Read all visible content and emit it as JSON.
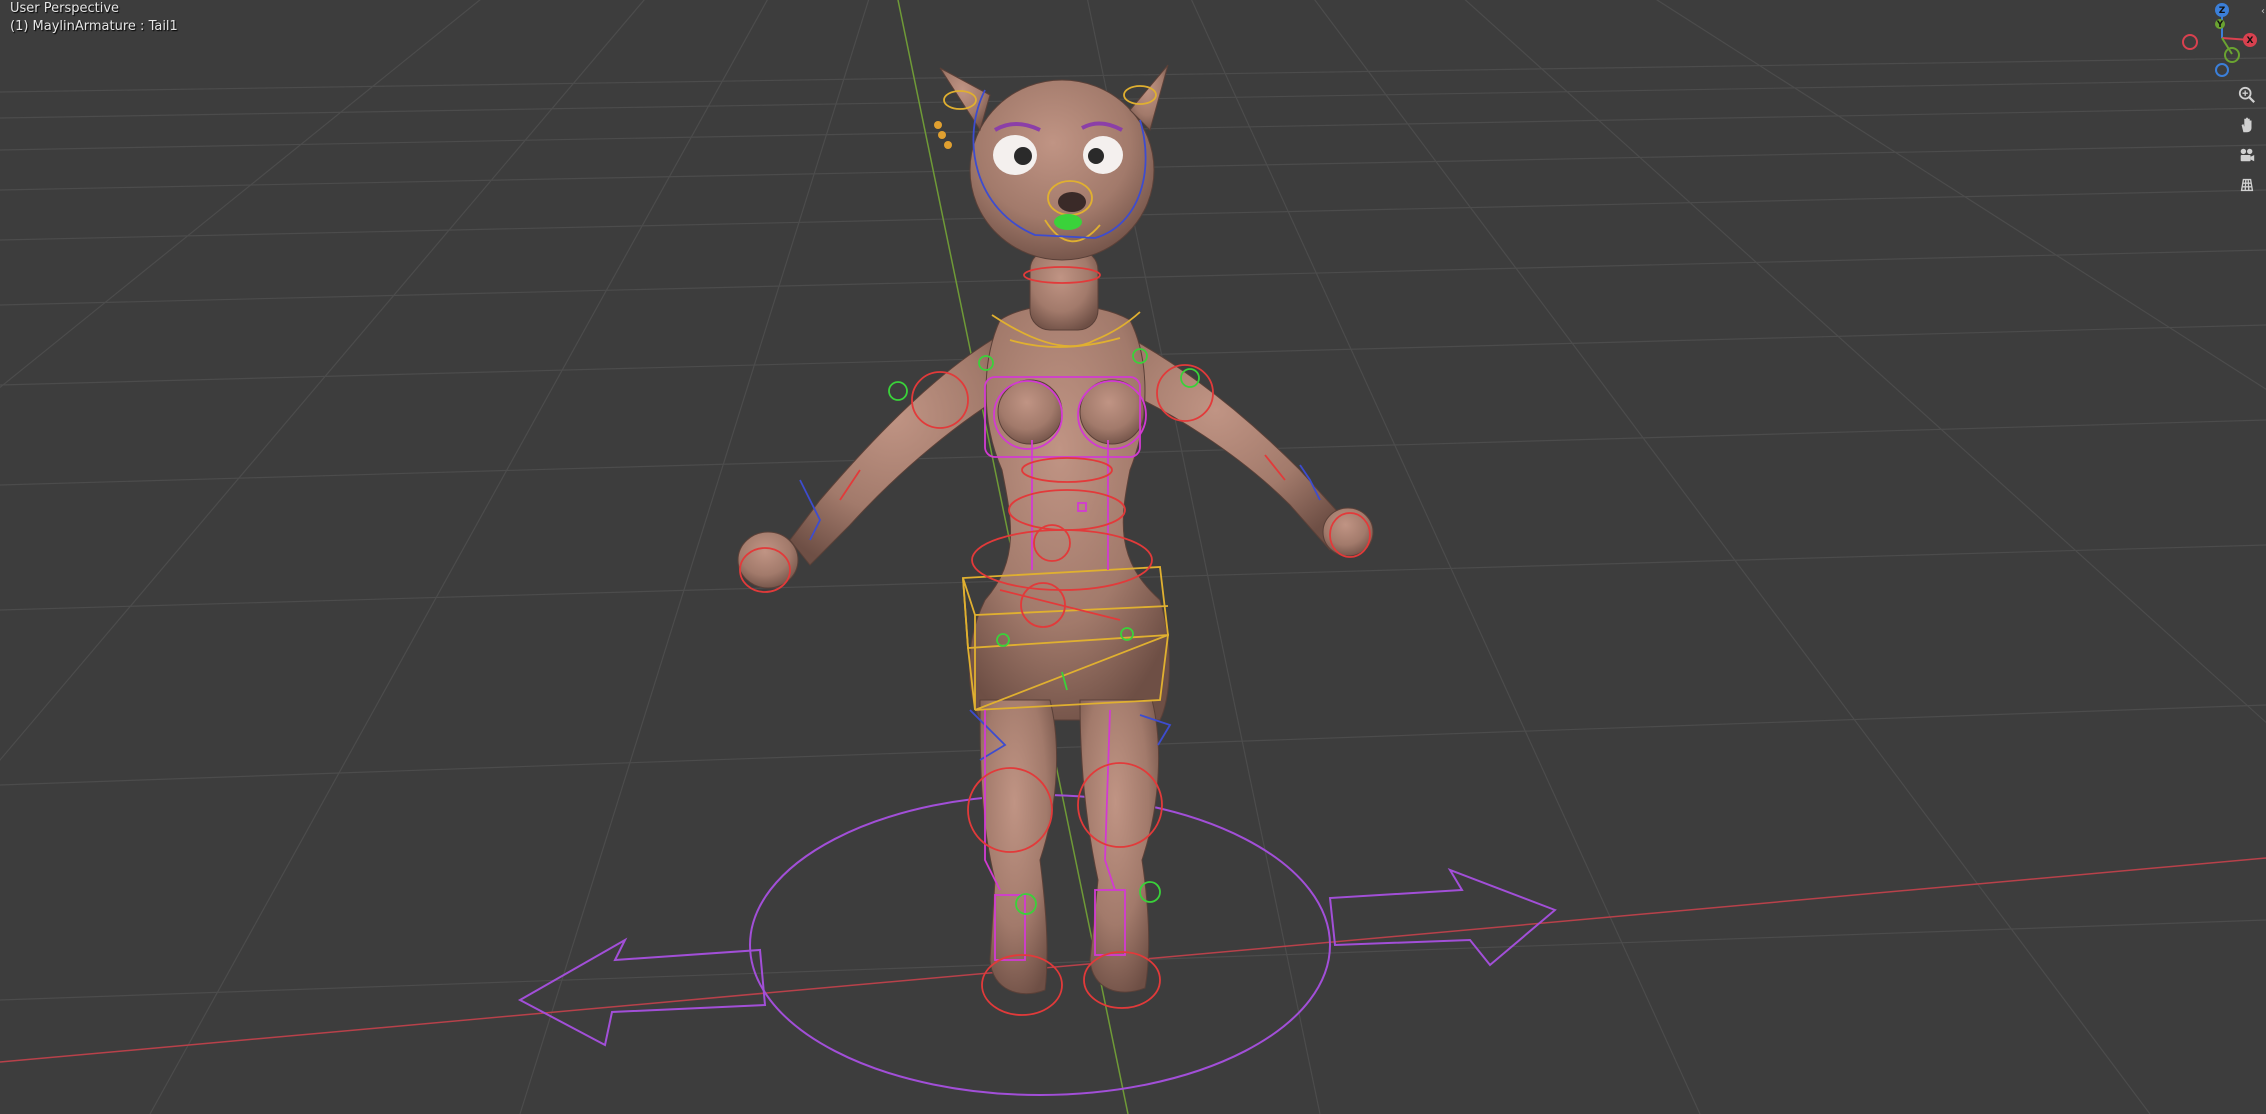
{
  "viewport": {
    "view_label": "User Perspective",
    "active_object_label": "(1) MaylinArmature : Tail1",
    "background_color": "#3d3d3d",
    "grid_color": "#505050",
    "x_axis_color": "#c0404a",
    "y_axis_color": "#7aa03a"
  },
  "gizmo": {
    "axes": [
      {
        "name": "Z",
        "color": "#3b7fd9"
      },
      {
        "name": "Y",
        "color": "#6aa331"
      },
      {
        "name": "X",
        "color": "#d9414f"
      }
    ]
  },
  "nav_buttons": [
    {
      "name": "zoom-icon"
    },
    {
      "name": "pan-hand-icon"
    },
    {
      "name": "camera-icon"
    },
    {
      "name": "ortho-grid-icon"
    }
  ],
  "rig_colors": {
    "body": "#a98273",
    "bone_red": "#e23a3a",
    "bone_blue": "#3d4ccf",
    "bone_magenta": "#d23ad2",
    "bone_yellow": "#e0b030",
    "bone_green": "#3ad23a",
    "root_purple": "#a24fd8"
  }
}
